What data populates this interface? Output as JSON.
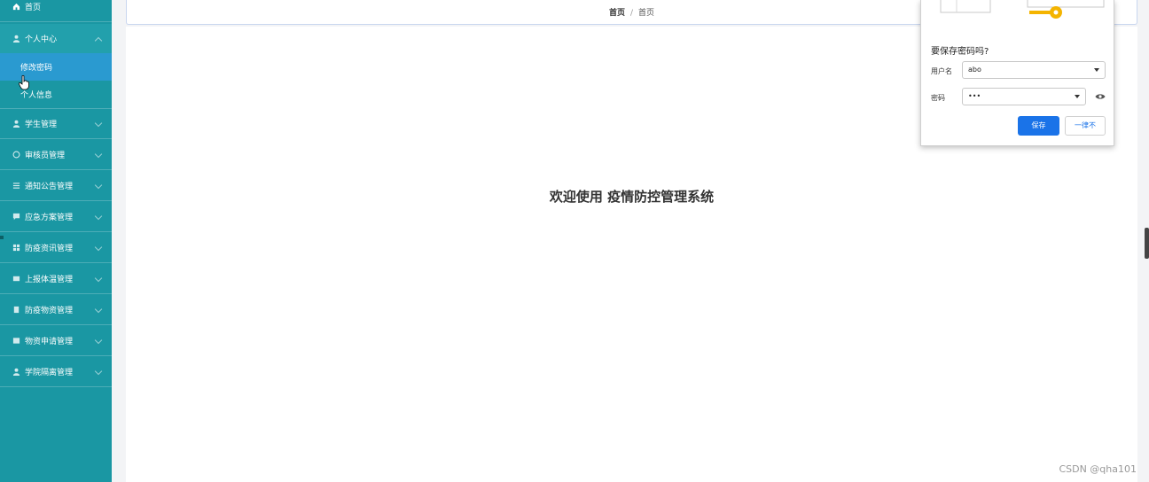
{
  "sidebar": {
    "home": "首页",
    "personal_center": {
      "label": "个人中心",
      "children": [
        "修改密码",
        "个人信息"
      ]
    },
    "items": [
      {
        "label": "学生管理",
        "icon": "user-icon"
      },
      {
        "label": "审核员管理",
        "icon": "badge-icon"
      },
      {
        "label": "通知公告管理",
        "icon": "list-icon"
      },
      {
        "label": "应急方案管理",
        "icon": "chat-icon"
      },
      {
        "label": "防疫资讯管理",
        "icon": "grid-icon"
      },
      {
        "label": "上报体温管理",
        "icon": "monitor-icon"
      },
      {
        "label": "防疫物资管理",
        "icon": "doc-icon"
      },
      {
        "label": "物资申请管理",
        "icon": "table-icon"
      },
      {
        "label": "学院隔离管理",
        "icon": "user-icon"
      }
    ]
  },
  "breadcrumb": {
    "home": "首页",
    "current": "首页"
  },
  "welcome": "欢迎使用 疫情防控管理系统",
  "password_popup": {
    "title": "要保存密码吗?",
    "username_label": "用户名",
    "username_value": "abo",
    "password_label": "密码",
    "password_value": "•••",
    "save_label": "保存",
    "never_label": "一律不"
  },
  "watermark": "CSDN @qha101",
  "colors": {
    "sidebar": "#1a97a3",
    "active_sub": "#2a9ad0",
    "primary_button": "#1a73e8"
  }
}
